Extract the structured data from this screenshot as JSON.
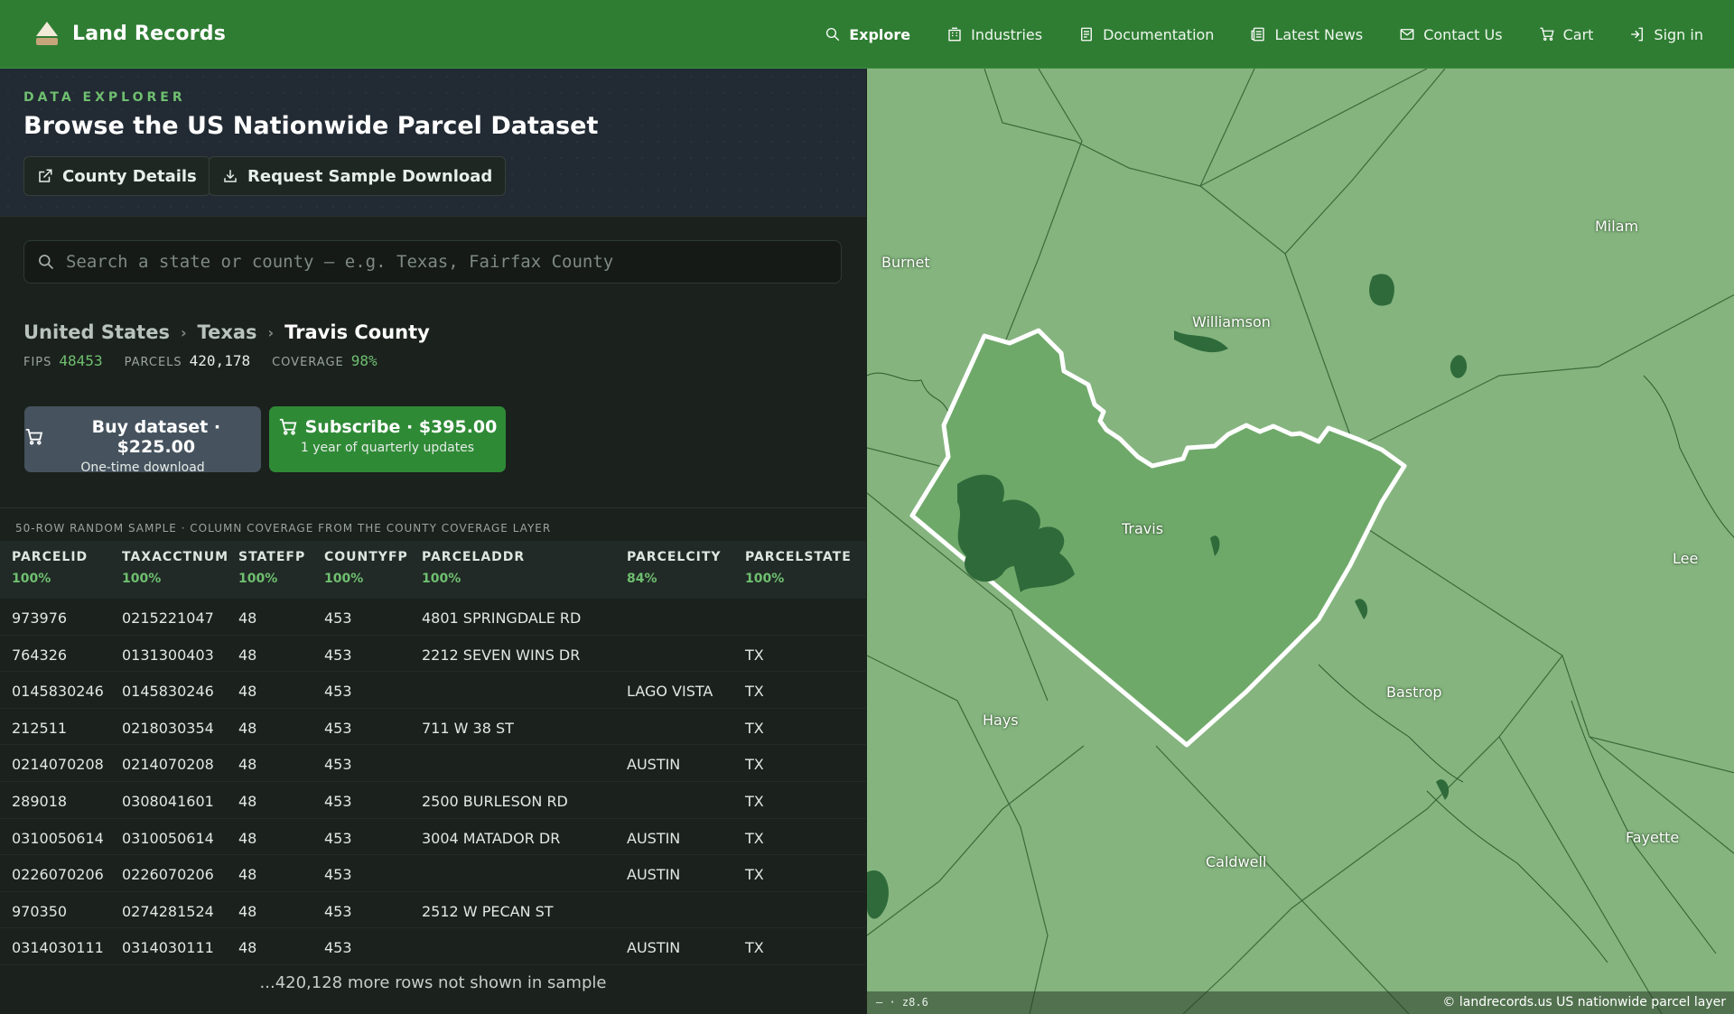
{
  "nav": {
    "brand": "Land Records",
    "items": [
      {
        "label": "Explore",
        "icon": "search-icon",
        "active": true
      },
      {
        "label": "Industries",
        "icon": "building-icon",
        "active": false
      },
      {
        "label": "Documentation",
        "icon": "document-icon",
        "active": false
      },
      {
        "label": "Latest News",
        "icon": "newspaper-icon",
        "active": false
      },
      {
        "label": "Contact Us",
        "icon": "mail-icon",
        "active": false
      },
      {
        "label": "Cart",
        "icon": "cart-icon",
        "active": false
      },
      {
        "label": "Sign in",
        "icon": "sign-in-icon",
        "active": false
      }
    ]
  },
  "hero": {
    "eyebrow": "DATA EXPLORER",
    "title": "Browse the US Nationwide Parcel Dataset",
    "county_details_label": "County Details",
    "sample_download_label": "Request Sample Download"
  },
  "search": {
    "placeholder": "Search a state or county — e.g. Texas, Fairfax County",
    "value": ""
  },
  "breadcrumb": {
    "country": "United States",
    "state": "Texas",
    "county": "Travis County"
  },
  "meta": {
    "fips_label": "FIPS",
    "fips": "48453",
    "parcels_label": "PARCELS",
    "parcels": "420,178",
    "coverage_label": "COVERAGE",
    "coverage": "98%"
  },
  "purchase": {
    "buy_label": "Buy dataset · $225.00",
    "buy_sub": "One-time download",
    "subscribe_label": "Subscribe · $395.00",
    "subscribe_sub": "1 year of quarterly updates"
  },
  "table": {
    "caption": "50-ROW RANDOM SAMPLE · COLUMN COVERAGE FROM THE COUNTY COVERAGE LAYER",
    "columns": [
      {
        "name": "PARCELID",
        "coverage": "100%"
      },
      {
        "name": "TAXACCTNUM",
        "coverage": "100%"
      },
      {
        "name": "STATEFP",
        "coverage": "100%"
      },
      {
        "name": "COUNTYFP",
        "coverage": "100%"
      },
      {
        "name": "PARCELADDR",
        "coverage": "100%"
      },
      {
        "name": "PARCELCITY",
        "coverage": "84%"
      },
      {
        "name": "PARCELSTATE",
        "coverage": "100%"
      }
    ],
    "rows": [
      [
        "973976",
        "0215221047",
        "48",
        "453",
        "4801 SPRINGDALE RD",
        "",
        ""
      ],
      [
        "764326",
        "0131300403",
        "48",
        "453",
        "2212 SEVEN WINS DR",
        "",
        "TX"
      ],
      [
        "0145830246",
        "0145830246",
        "48",
        "453",
        "",
        "LAGO VISTA",
        "TX"
      ],
      [
        "212511",
        "0218030354",
        "48",
        "453",
        "711 W 38 ST",
        "",
        "TX"
      ],
      [
        "0214070208",
        "0214070208",
        "48",
        "453",
        "",
        "AUSTIN",
        "TX"
      ],
      [
        "289018",
        "0308041601",
        "48",
        "453",
        "2500 BURLESON RD",
        "",
        "TX"
      ],
      [
        "0310050614",
        "0310050614",
        "48",
        "453",
        "3004 MATADOR DR",
        "AUSTIN",
        "TX"
      ],
      [
        "0226070206",
        "0226070206",
        "48",
        "453",
        "",
        "AUSTIN",
        "TX"
      ],
      [
        "970350",
        "0274281524",
        "48",
        "453",
        "2512 W PECAN ST",
        "",
        ""
      ],
      [
        "0314030111",
        "0314030111",
        "48",
        "453",
        "",
        "AUSTIN",
        "TX"
      ]
    ],
    "more_text": "...420,128 more rows not shown in sample"
  },
  "map": {
    "places": [
      "Burnet",
      "Williamson",
      "Milam",
      "Travis",
      "Lee",
      "Bastrop",
      "Hays",
      "Caldwell",
      "Fayette"
    ],
    "zoom_text": "— · z8.6",
    "attribution": "© landrecords.us US nationwide parcel layer",
    "colors": {
      "land": "#85b47f",
      "highlight": "#6fa96a",
      "water": "#2f6b3a",
      "outline": "#ffffff"
    }
  }
}
